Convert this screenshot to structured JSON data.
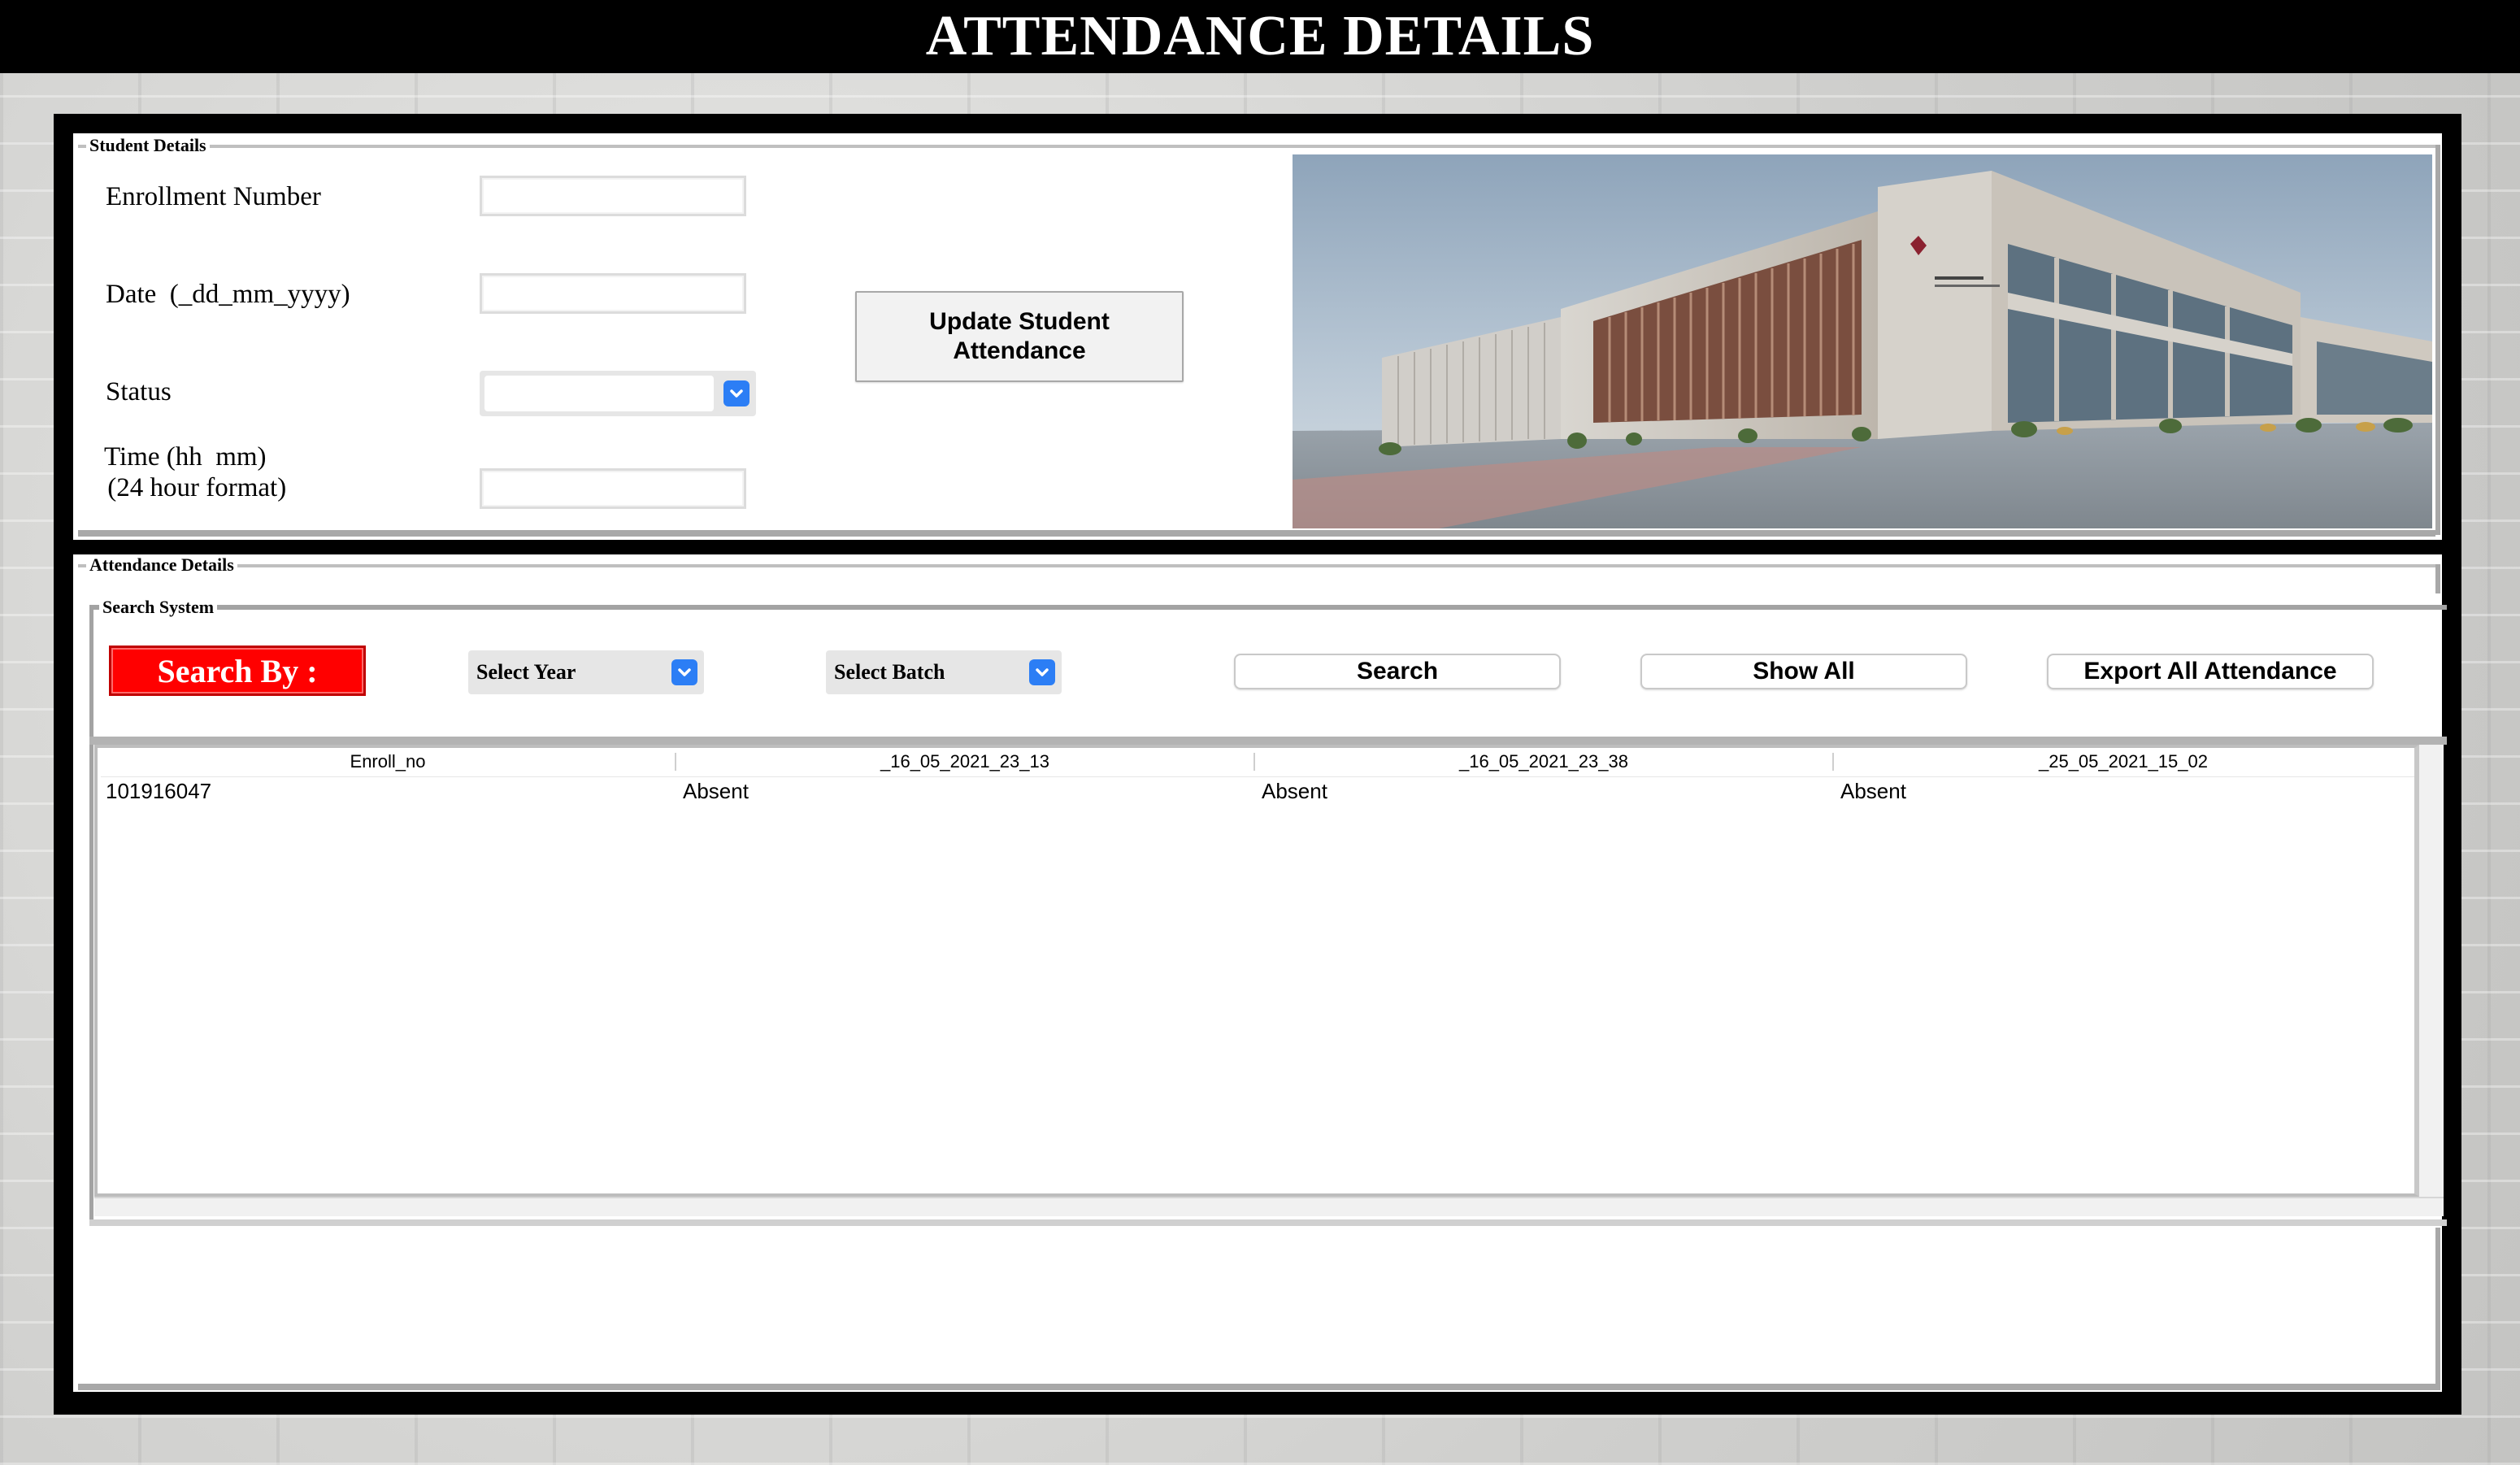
{
  "window": {
    "title": "ATTENDANCE DETAILS"
  },
  "student_details": {
    "legend": "Student Details",
    "enrollment_label": "Enrollment Number",
    "enrollment_value": "",
    "date_label": "Date  (_dd_mm_yyyy)",
    "date_value": "",
    "status_label": "Status",
    "status_value": "",
    "time_label_line1": "Time (hh  mm)",
    "time_label_line2": " (24 hour format)",
    "time_value": "",
    "update_button_line1": "Update Student",
    "update_button_line2": "Attendance"
  },
  "attendance_details": {
    "legend": "Attendance Details",
    "search_system": {
      "legend": "Search System",
      "search_by_label": "Search By :",
      "select_year": "Select Year",
      "select_batch": "Select Batch",
      "search_button": "Search",
      "show_all_button": "Show All",
      "export_button": "Export All Attendance"
    },
    "table": {
      "columns": [
        "Enroll_no",
        "_16_05_2021_23_13",
        "_16_05_2021_23_38",
        "_25_05_2021_15_02"
      ],
      "rows": [
        [
          "101916047",
          "Absent",
          "Absent",
          "Absent"
        ]
      ]
    }
  },
  "colors": {
    "title_bar": "#000000",
    "search_by_bg": "#ff0000",
    "dropdown_accent": "#2c7ef5"
  },
  "icons": {
    "dropdown": "chevron-down-icon",
    "image": "university-building-photo"
  }
}
